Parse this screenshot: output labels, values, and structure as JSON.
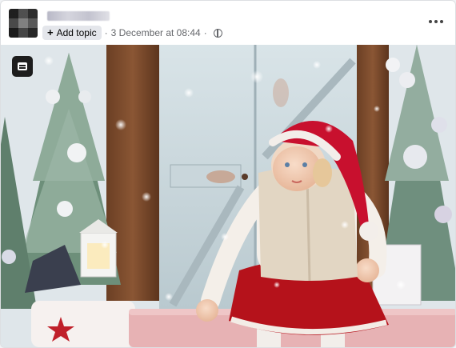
{
  "post": {
    "add_topic_label": "Add topic",
    "timestamp": "3 December at 08:44",
    "separator": "·",
    "audience_icon": "globe-icon",
    "menu_icon": "more-options-icon",
    "photo_badge_icon": "chat-badge-icon"
  },
  "colors": {
    "header_bg": "#ffffff",
    "chip_bg": "#e4e6eb",
    "meta_text": "#65676b",
    "hat_red": "#c8102e",
    "skirt_red": "#b5121b"
  }
}
